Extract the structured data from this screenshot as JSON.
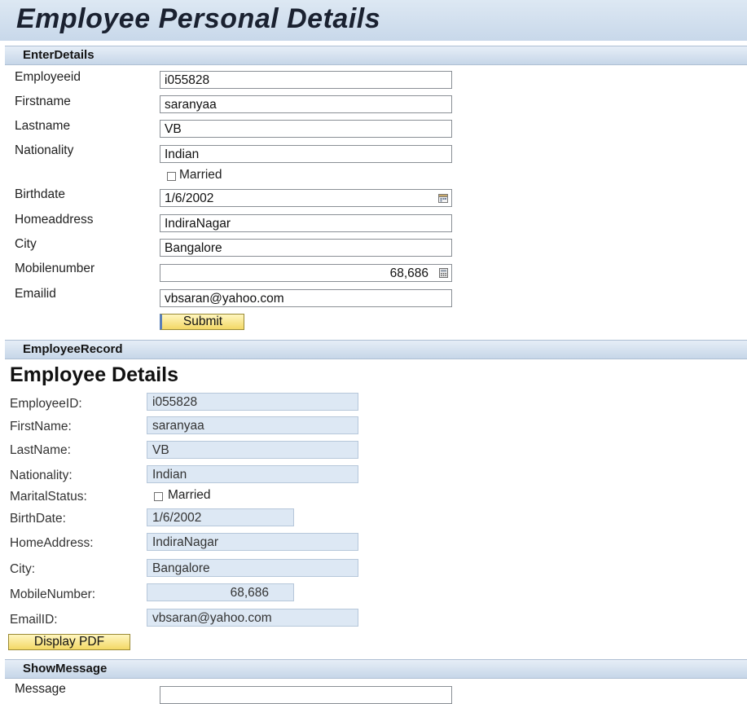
{
  "page": {
    "title": "Employee Personal Details"
  },
  "enter_details": {
    "header": "EnterDetails",
    "fields": {
      "employee_id": {
        "label": "Employeeid",
        "value": "i055828"
      },
      "first_name": {
        "label": "Firstname",
        "value": "saranyaa"
      },
      "last_name": {
        "label": "Lastname",
        "value": "VB"
      },
      "nationality": {
        "label": "Nationality",
        "value": "Indian"
      },
      "married": {
        "label": "Married",
        "checked": false
      },
      "birthdate": {
        "label": "Birthdate",
        "value": "1/6/2002"
      },
      "home_address": {
        "label": "Homeaddress",
        "value": "IndiraNagar"
      },
      "city": {
        "label": "City",
        "value": "Bangalore"
      },
      "mobile": {
        "label": "Mobilenumber",
        "value": "68,686"
      },
      "email": {
        "label": "Emailid",
        "value": "vbsaran@yahoo.com"
      }
    },
    "submit_label": "Submit"
  },
  "employee_record": {
    "header": "EmployeeRecord",
    "title": "Employee Details",
    "rows": {
      "employee_id": {
        "label": "EmployeeID:",
        "value": "i055828"
      },
      "first_name": {
        "label": "FirstName:",
        "value": "saranyaa"
      },
      "last_name": {
        "label": "LastName:",
        "value": "VB"
      },
      "nationality": {
        "label": "Nationality:",
        "value": "Indian"
      },
      "marital_status": {
        "label": "MaritalStatus:",
        "checkbox_label": "Married",
        "checked": false
      },
      "birthdate": {
        "label": "BirthDate:",
        "value": "1/6/2002"
      },
      "home_address": {
        "label": "HomeAddress:",
        "value": "IndiraNagar"
      },
      "city": {
        "label": "City:",
        "value": "Bangalore"
      },
      "mobile": {
        "label": "MobileNumber:",
        "value": "68,686"
      },
      "email": {
        "label": "EmailID:",
        "value": "vbsaran@yahoo.com"
      }
    },
    "display_pdf_label": "Display PDF"
  },
  "show_message": {
    "header": "ShowMessage",
    "message_label": "Message",
    "message_value": ""
  },
  "icons": {
    "birthdate_picker": "calendar-icon",
    "mobile_calculator": "calculator-icon"
  },
  "colors": {
    "section_header": "#c6d6e8",
    "readonly_field": "#dde8f4",
    "button": "#f3d865"
  }
}
